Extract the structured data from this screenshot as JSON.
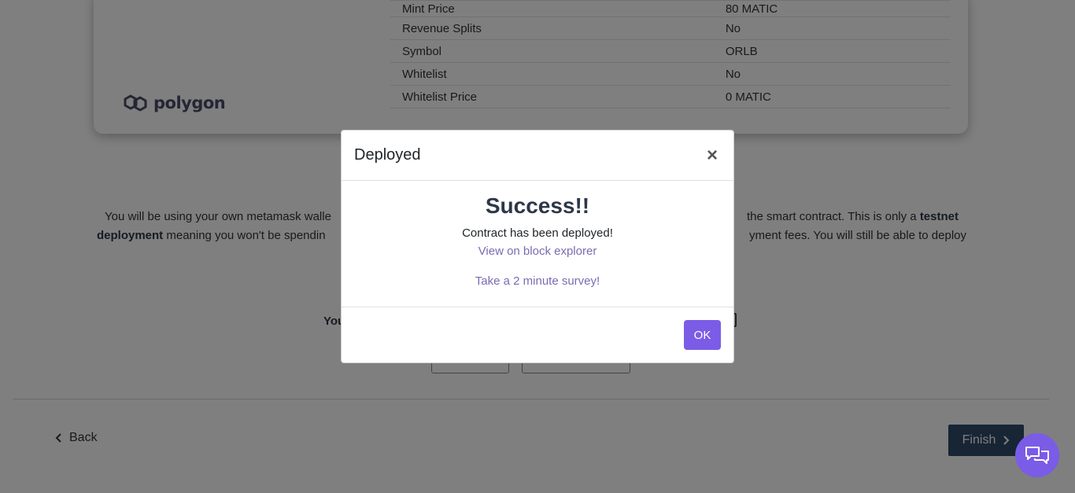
{
  "details": [
    {
      "label": "Mint Price",
      "value": "80 MATIC"
    },
    {
      "label": "Revenue Splits",
      "value": "No"
    },
    {
      "label": "Symbol",
      "value": "ORLB"
    },
    {
      "label": "Whitelist",
      "value": "No"
    },
    {
      "label": "Whitelist Price",
      "value": "0 MATIC"
    }
  ],
  "brand": {
    "logo_text": "polygon"
  },
  "info": {
    "part1": "You will be using your own metamask walle",
    "part2": "the smart contract. This is only a",
    "bold1": "testnet",
    "bold2": "deployment",
    "part3": "meaning you won't be spendin",
    "part4": "yment fees. You will still be able to deploy"
  },
  "wallet_label": "You",
  "nav": {
    "back_label": "Back",
    "finish_label": "Finish"
  },
  "modal": {
    "title": "Deployed",
    "close_symbol": "×",
    "heading": "Success!!",
    "message": "Contract has been deployed!",
    "explorer_link": "View on block explorer",
    "survey_link": "Take a 2 minute survey!",
    "ok_label": "OK"
  },
  "icons": {
    "brand": "polygon-logo-icon",
    "back": "chevron-left-icon",
    "finish": "chevron-right-icon",
    "chat": "chat-bubbles-icon",
    "close": "close-icon"
  },
  "colors": {
    "accent": "#7b5ce6",
    "finish": "#2f4a6b",
    "link": "#7c6bb3"
  }
}
